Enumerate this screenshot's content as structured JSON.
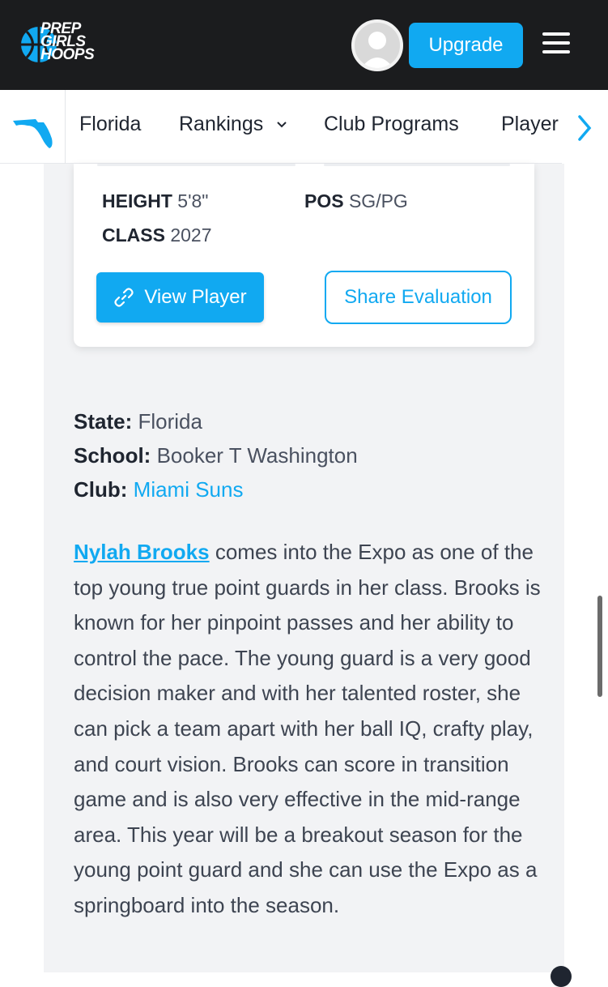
{
  "header": {
    "logo_lines": [
      "PREP",
      "GIRLS",
      "HOOPS"
    ],
    "upgrade_label": "Upgrade"
  },
  "subnav": {
    "items": [
      {
        "label": "Florida"
      },
      {
        "label": "Rankings"
      },
      {
        "label": "Club Programs"
      },
      {
        "label": "Player"
      }
    ]
  },
  "player_card": {
    "height_label": "HEIGHT",
    "height_value": "5'8\"",
    "pos_label": "POS",
    "pos_value": "SG/PG",
    "class_label": "CLASS",
    "class_value": "2027",
    "view_player_label": "View Player",
    "share_evaluation_label": "Share Evaluation"
  },
  "meta": {
    "state_label": "State:",
    "state_value": "Florida",
    "school_label": "School:",
    "school_value": "Booker T Washington",
    "club_label": "Club:",
    "club_value": "Miami Suns"
  },
  "article": {
    "player_name": "Nylah Brooks",
    "text": " comes into the Expo as one of the top young true point guards in her class. Brooks is known for her pinpoint passes and her ability to control the pace. The young guard is a very good decision maker and with her talented roster, she can pick a team apart with her ball IQ, crafty play, and court vision. Brooks can score in transition game and is also very effective in the mid-range area. This year will be a breakout season for the young point guard and she can use the Expo as a springboard into the season."
  },
  "colors": {
    "accent": "#11a9f1",
    "header_bg": "#1b1c1e",
    "content_bg": "#f2f3f5"
  }
}
